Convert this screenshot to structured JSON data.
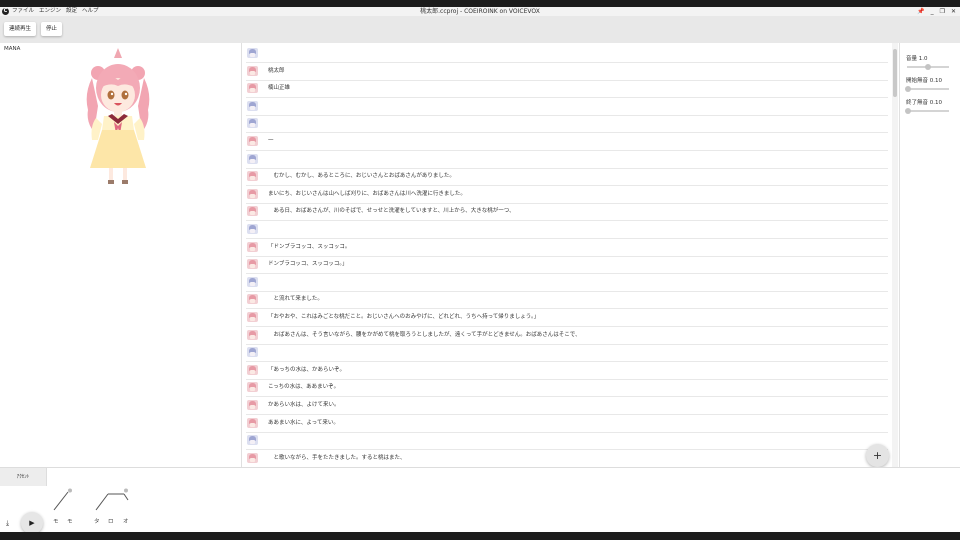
{
  "app": {
    "logo_letter": "C",
    "menu": [
      "ファイル",
      "エンジン",
      "設定",
      "ヘルプ"
    ],
    "title": "桃太郎.ccproj - COEIROINK on VOICEVOX",
    "window_controls": {
      "pin": "📌",
      "minimize": "_",
      "maximize": "❐",
      "close": "✕"
    }
  },
  "toolbar": {
    "play_all": "連続再生",
    "stop": "停止"
  },
  "character": {
    "name": "MANA"
  },
  "rows": [
    {
      "voice": "b",
      "text": ""
    },
    {
      "voice": "r",
      "text": "桃太郎"
    },
    {
      "voice": "r",
      "text": "楠山正雄"
    },
    {
      "voice": "b",
      "text": ""
    },
    {
      "voice": "b",
      "text": ""
    },
    {
      "voice": "r",
      "text": "一"
    },
    {
      "voice": "b",
      "text": ""
    },
    {
      "voice": "r",
      "text": "　むかし、むかし、あるところに、おじいさんとおばあさんがありました。"
    },
    {
      "voice": "r",
      "text": "まいにち、おじいさんは山へしば刈りに、おばあさんは川へ洗濯に行きました。"
    },
    {
      "voice": "r",
      "text": "　ある日、おばあさんが、川のそばで、せっせと洗濯をしていますと、川上から、大きな桃が一つ、"
    },
    {
      "voice": "b",
      "text": ""
    },
    {
      "voice": "r",
      "text": "「ドンブラコッコ、スッコッコ。"
    },
    {
      "voice": "r",
      "text": "ドンブラコッコ、スッコッコ。」"
    },
    {
      "voice": "b",
      "text": ""
    },
    {
      "voice": "r",
      "text": "　と流れて来ました。"
    },
    {
      "voice": "r",
      "text": "「おやおや、これはみごとな桃だこと。おじいさんへのおみやげに、どれどれ、うちへ持って帰りましょう。」"
    },
    {
      "voice": "r",
      "text": "　おばあさんは、そう言いながら、腰をかがめて桃を取ろうとしましたが、遠くって手がとどきません。おばあさんはそこで、"
    },
    {
      "voice": "b",
      "text": ""
    },
    {
      "voice": "r",
      "text": "「あっちの水は、かあらいぞ。"
    },
    {
      "voice": "r",
      "text": "こっちの水は、ああまいぞ。"
    },
    {
      "voice": "r",
      "text": "かあらい水は、よけて来い。"
    },
    {
      "voice": "r",
      "text": "ああまい水に、よって来い。"
    },
    {
      "voice": "b",
      "text": ""
    },
    {
      "voice": "r",
      "text": "　と歌いながら、手をたたきました。すると桃はまた、"
    }
  ],
  "add_button": "+",
  "parameters": [
    {
      "label": "音量 1.0",
      "level": 0.5
    },
    {
      "label": "開始無音 0.10",
      "level": 0.03
    },
    {
      "label": "終了無音 0.10",
      "level": 0.03
    }
  ],
  "bottom": {
    "accent_tab": "ｱｸｾﾝﾄ",
    "moras": [
      "モ",
      "モ",
      "タ",
      "ロ",
      "オ"
    ],
    "download_icon": "⤓",
    "play_icon": "▶"
  }
}
